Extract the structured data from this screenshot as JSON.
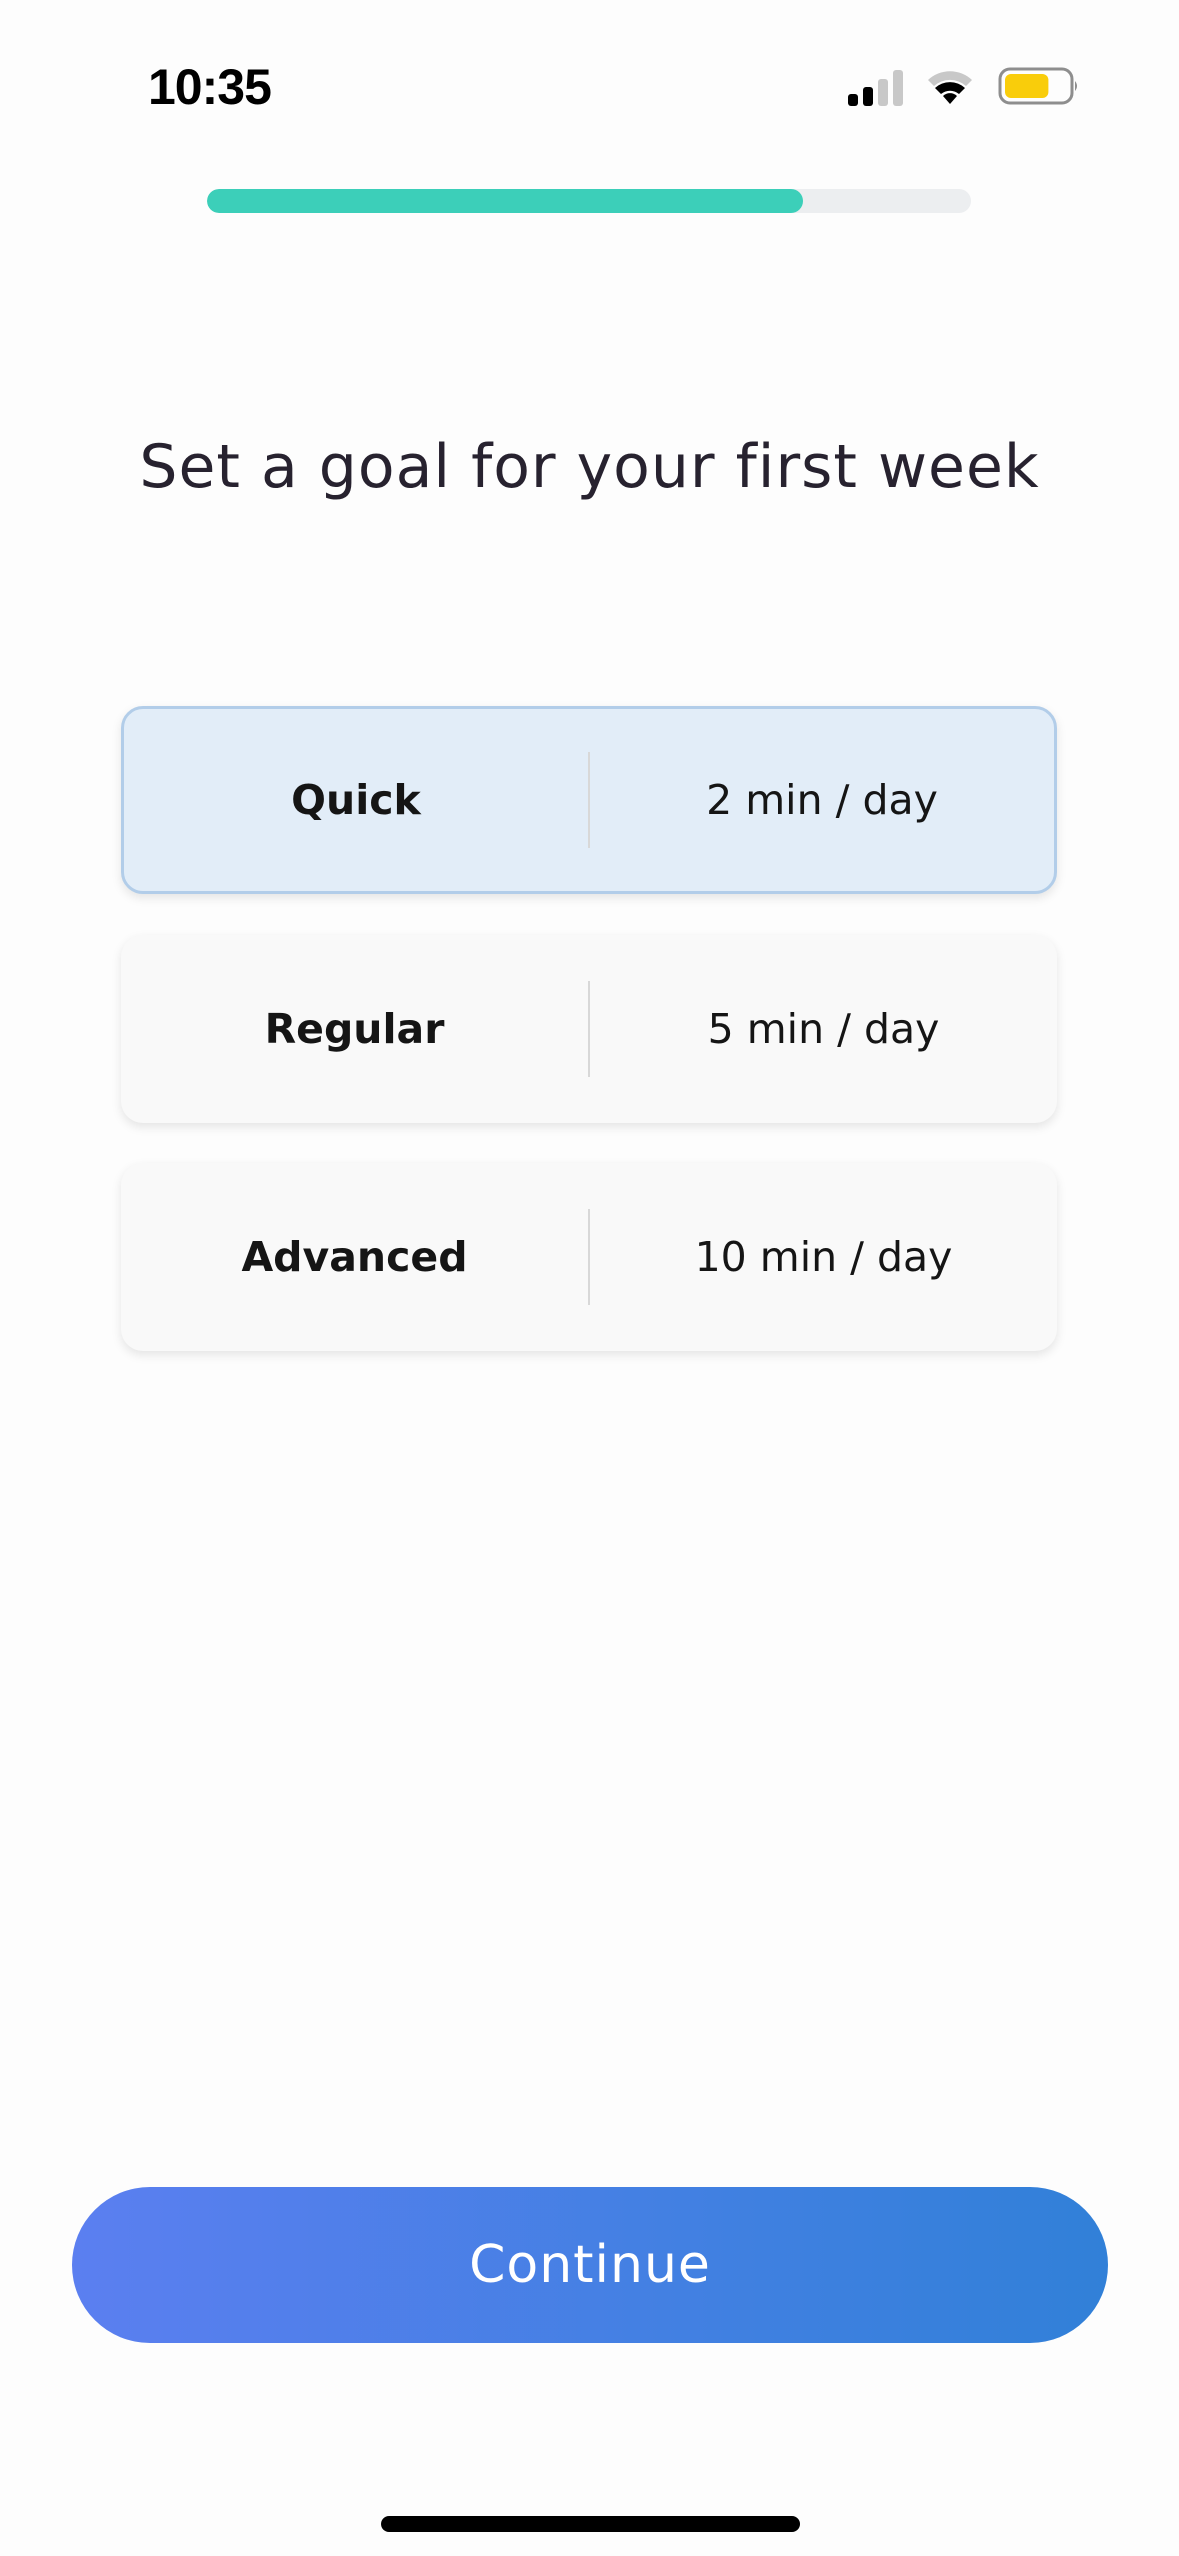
{
  "status_bar": {
    "time": "10:35",
    "signal_bars_active": 2,
    "signal_bars_total": 4,
    "wifi_arcs_active": 2,
    "battery_level": 0.7,
    "battery_color": "#f9cd0b"
  },
  "progress": {
    "fraction": 0.78,
    "fill_color": "#3ccfb9",
    "track_color": "#eceef0"
  },
  "title": "Set a goal for your first week",
  "options": [
    {
      "label": "Quick",
      "duration": "2 min / day",
      "selected": true
    },
    {
      "label": "Regular",
      "duration": "5 min / day",
      "selected": false
    },
    {
      "label": "Advanced",
      "duration": "10 min / day",
      "selected": false
    }
  ],
  "continue_button": {
    "label": "Continue",
    "gradient_start": "#5b7ff0",
    "gradient_end": "#3180d8"
  }
}
